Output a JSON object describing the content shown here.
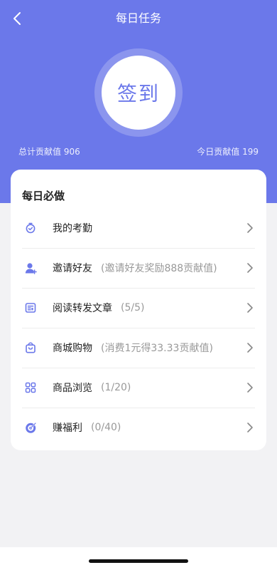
{
  "header": {
    "title": "每日任务",
    "sign_label": "签到",
    "total_label": "总计贡献值 906",
    "today_label": "今日贡献值 199"
  },
  "colors": {
    "primary": "#6b78ea",
    "text": "#222222",
    "muted": "#999999"
  },
  "section": {
    "title": "每日必做",
    "items": [
      {
        "icon": "clock-check-icon",
        "label": "我的考勤",
        "note": ""
      },
      {
        "icon": "add-user-icon",
        "label": "邀请好友",
        "note": "(邀请好友奖励888贡献值)"
      },
      {
        "icon": "article-icon",
        "label": "阅读转发文章",
        "note": "(5/5)"
      },
      {
        "icon": "shopping-bag-icon",
        "label": "商城购物",
        "note": "(消费1元得33.33贡献值)"
      },
      {
        "icon": "grid-icon",
        "label": "商品浏览",
        "note": "(1/20)"
      },
      {
        "icon": "target-icon",
        "label": "赚福利",
        "note": "(0/40)"
      }
    ]
  }
}
